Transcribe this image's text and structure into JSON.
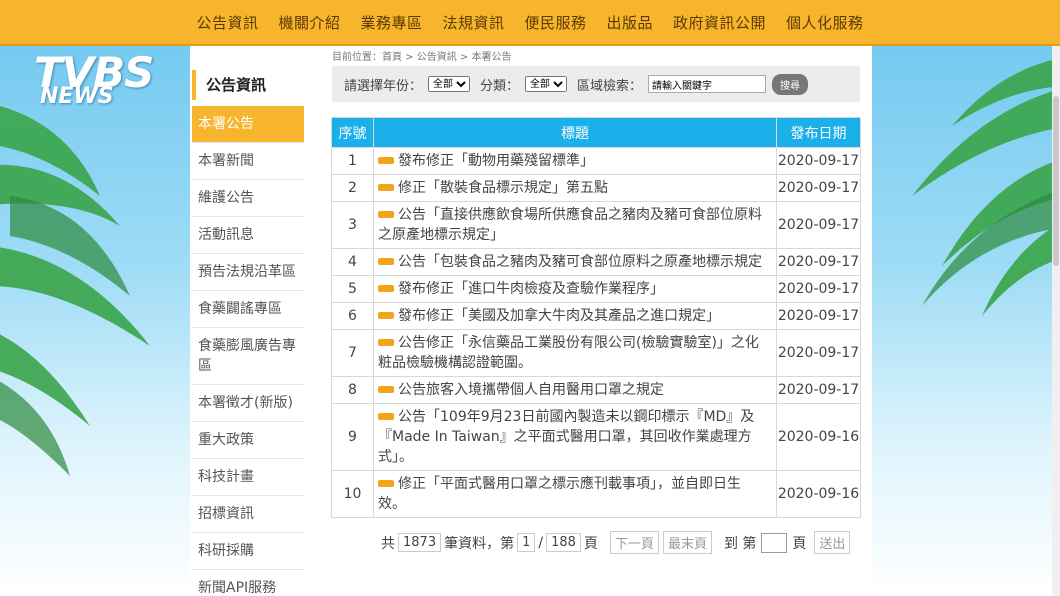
{
  "topnav": {
    "items": [
      "公告資訊",
      "機關介紹",
      "業務專區",
      "法規資訊",
      "便民服務",
      "出版品",
      "政府資訊公開",
      "個人化服務"
    ]
  },
  "logo": {
    "main": "TVBS",
    "sub": "NEWS"
  },
  "sidebar": {
    "title": "公告資訊",
    "items": [
      {
        "label": "本署公告",
        "active": true
      },
      {
        "label": "本署新聞"
      },
      {
        "label": "維護公告"
      },
      {
        "label": "活動訊息"
      },
      {
        "label": "預告法規沿革區"
      },
      {
        "label": "食藥闢謠專區"
      },
      {
        "label": "食藥膨風廣告專區"
      },
      {
        "label": "本署徵才(新版)"
      },
      {
        "label": "重大政策"
      },
      {
        "label": "科技計畫"
      },
      {
        "label": "招標資訊"
      },
      {
        "label": "科研採購"
      },
      {
        "label": "新聞API服務"
      }
    ]
  },
  "breadcrumb": {
    "text": "目前位置：首頁 > 公告資訊 > 本署公告"
  },
  "filter": {
    "year_label": "請選擇年份：",
    "year_value": "全部",
    "category_label": "分類：",
    "category_value": "全部",
    "search_label": "區域檢索：",
    "search_value": "請輸入關鍵字",
    "search_button": "搜尋"
  },
  "table": {
    "headers": {
      "no": "序號",
      "title": "標題",
      "date": "發布日期"
    },
    "rows": [
      {
        "no": "1",
        "title": "發布修正「動物用藥殘留標準」",
        "date": "2020-09-17"
      },
      {
        "no": "2",
        "title": "修正「散裝食品標示規定」第五點",
        "date": "2020-09-17"
      },
      {
        "no": "3",
        "title": "公告「直接供應飲食場所供應食品之豬肉及豬可食部位原料之原產地標示規定」",
        "date": "2020-09-17"
      },
      {
        "no": "4",
        "title": "公告「包裝食品之豬肉及豬可食部位原料之原產地標示規定",
        "date": "2020-09-17"
      },
      {
        "no": "5",
        "title": "發布修正「進口牛肉檢疫及查驗作業程序」",
        "date": "2020-09-17"
      },
      {
        "no": "6",
        "title": "發布修正「美國及加拿大牛肉及其產品之進口規定」",
        "date": "2020-09-17"
      },
      {
        "no": "7",
        "title": "公告修正「永信藥品工業股份有限公司(檢驗實驗室)」之化粧品檢驗機構認證範圍。",
        "date": "2020-09-17"
      },
      {
        "no": "8",
        "title": "公告旅客入境攜帶個人自用醫用口罩之規定",
        "date": "2020-09-17"
      },
      {
        "no": "9",
        "title": "公告「109年9月23日前國內製造未以鋼印標示『MD』及『Made In Taiwan』之平面式醫用口罩，其回收作業處理方式」。",
        "date": "2020-09-16"
      },
      {
        "no": "10",
        "title": "修正「平面式醫用口罩之標示應刊載事項」，並自即日生效。",
        "date": "2020-09-16"
      }
    ]
  },
  "pager": {
    "total_prefix": "共",
    "total_count": "1873",
    "total_suffix": "筆資料，第",
    "current_page": "1",
    "slash": "/",
    "total_pages": "188",
    "page_word": "頁",
    "next_label": "下一頁",
    "last_label": "最末頁",
    "goto_prefix": "到 第",
    "goto_suffix": "頁",
    "submit_label": "送出"
  }
}
